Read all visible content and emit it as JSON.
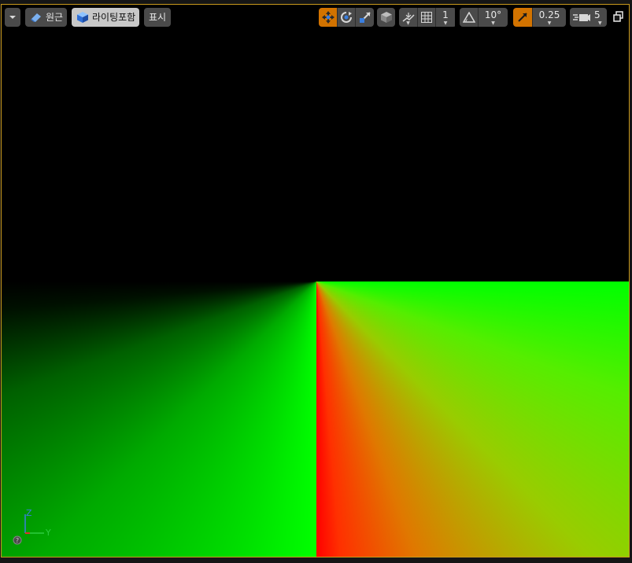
{
  "toolbar": {
    "view_mode_label": "원근",
    "lighting_label": "라이팅포함",
    "show_label": "표시",
    "rotation_snap_value": "10°",
    "scale_snap_value": "0.25",
    "grid_snap_value": "1",
    "camera_speed_value": "5"
  },
  "axis": {
    "z_label": "Z",
    "y_label": "Y"
  },
  "colors": {
    "viewport_border": "#c99a1d",
    "toolbar_button": "#4a4a4a",
    "active_button": "#c8c8c8",
    "accent_orange": "#d27300"
  },
  "icons": {
    "dropdown": "chevron-down-icon",
    "perspective": "eraser-icon",
    "lit": "cube-icon",
    "translate": "move-icon",
    "rotate": "rotate-icon",
    "scale": "scale-icon",
    "world": "world-cube-icon",
    "surface_snap": "surface-snap-icon",
    "grid": "grid-icon",
    "angle": "angle-icon",
    "scale_snap": "scale-arrow-icon",
    "camera": "camera-speed-icon",
    "restore": "restore-icon",
    "help": "help-icon"
  }
}
